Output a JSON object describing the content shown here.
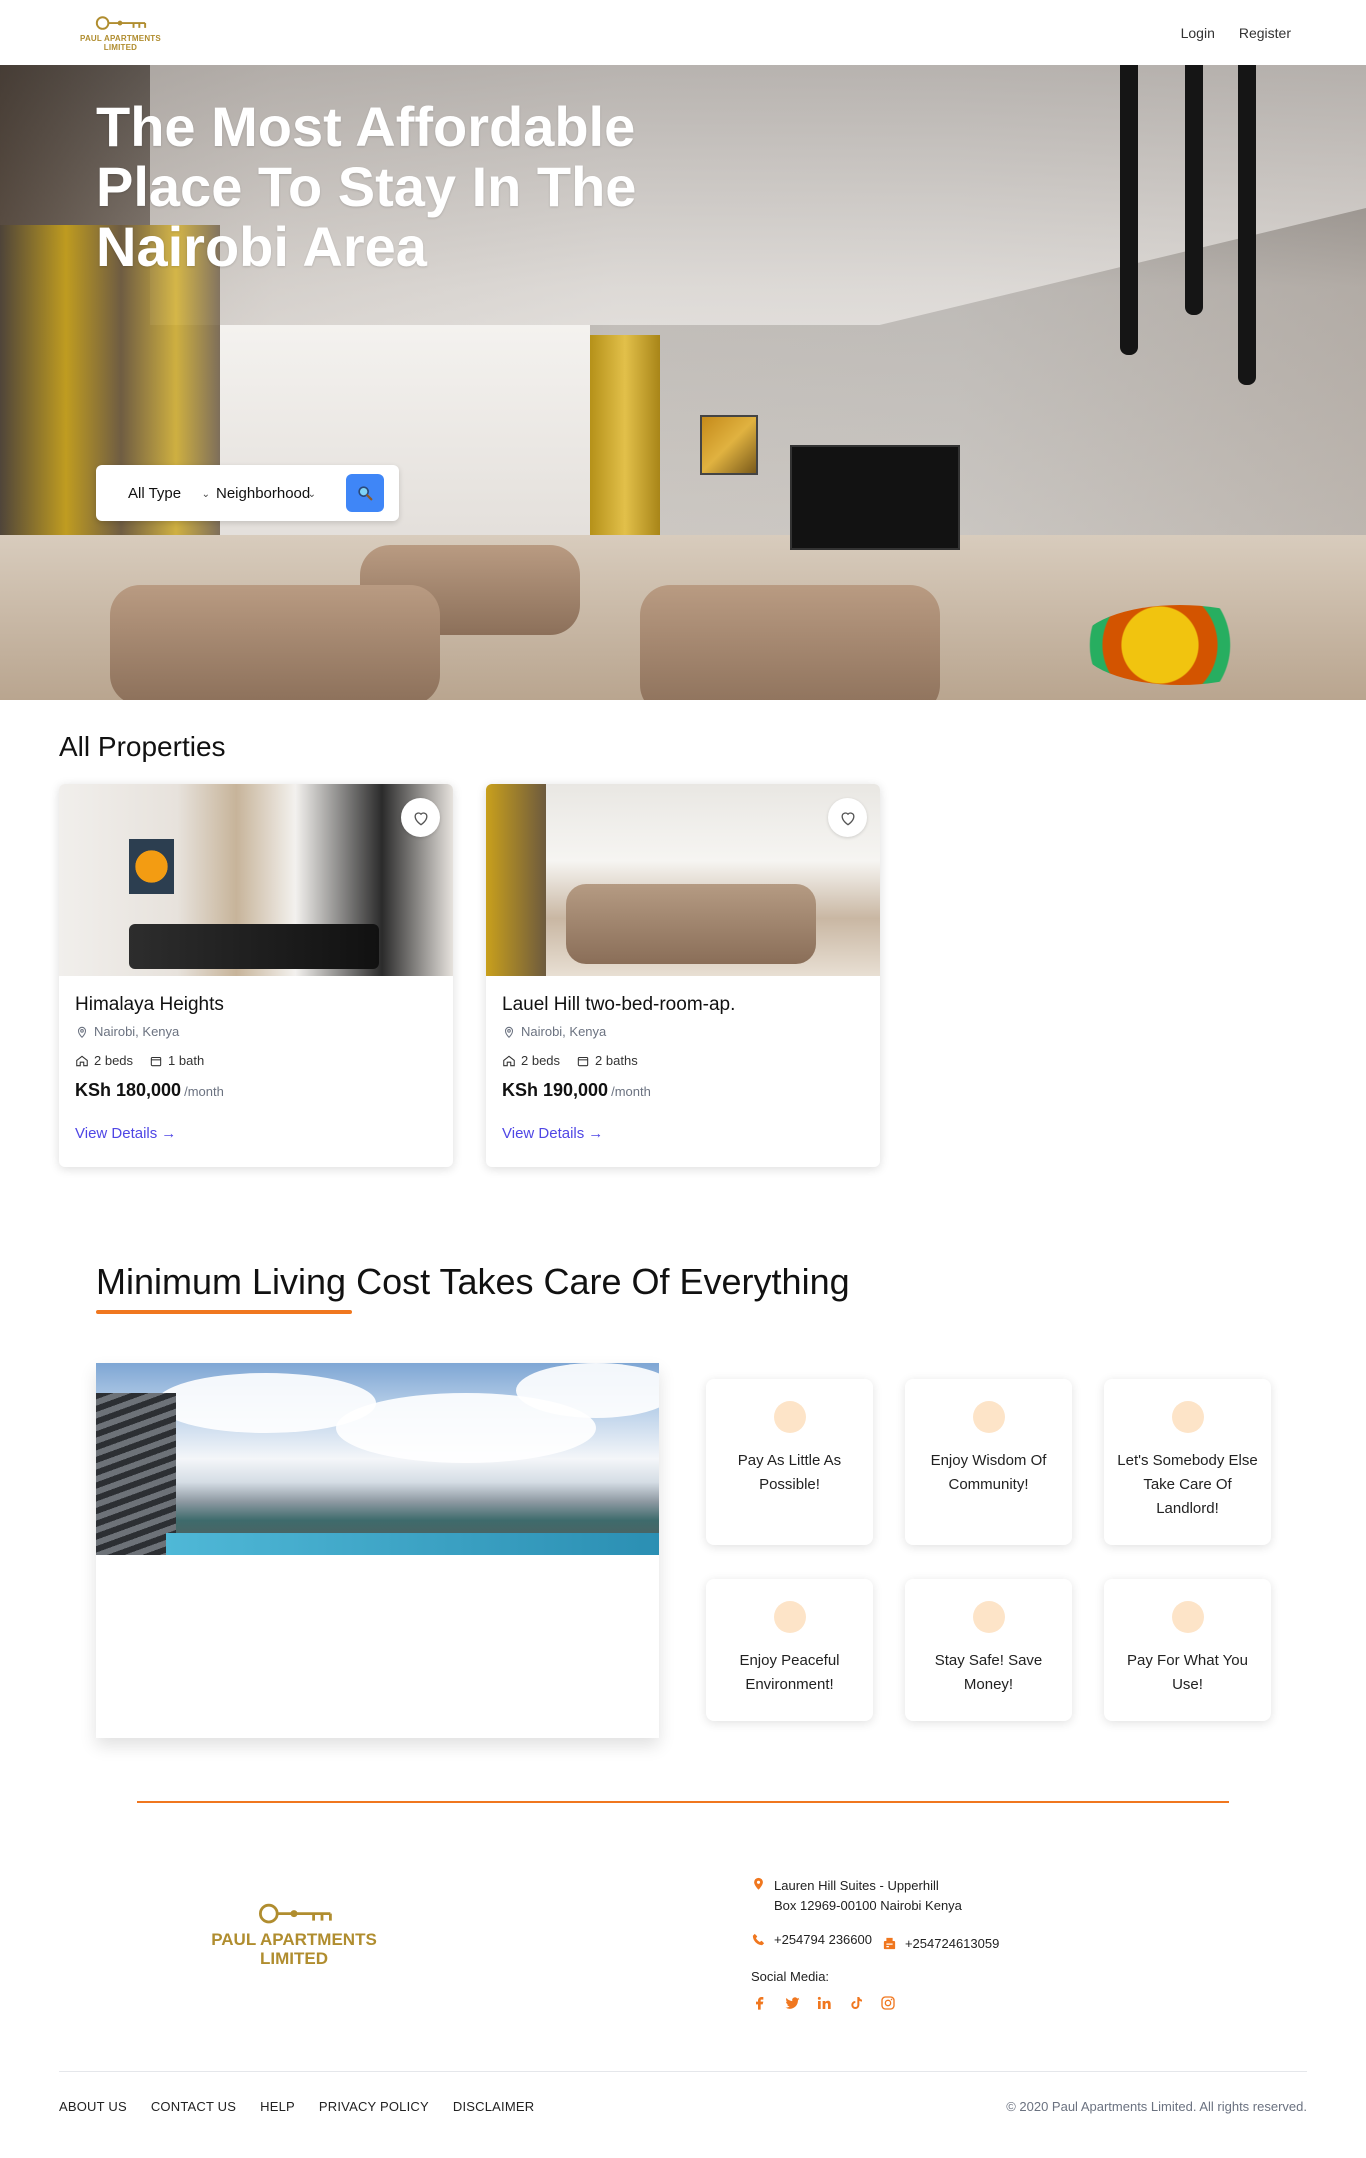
{
  "brand": {
    "name_line1": "PAUL APARTMENTS",
    "name_line2": "LIMITED",
    "color": "#b08d2f"
  },
  "header": {
    "login_label": "Login",
    "register_label": "Register"
  },
  "hero": {
    "title": "The Most Affordable Place To Stay In The Nairobi Area",
    "type_select": "All Type",
    "neighborhood_select": "Neighborhood",
    "search_icon": "search-icon",
    "search_button_color": "#3f86f7"
  },
  "properties": {
    "title": "All Properties",
    "items": [
      {
        "name": "Himalaya Heights",
        "location": "Nairobi, Kenya",
        "beds": "2 beds",
        "baths": "1 bath",
        "price": "KSh 180,000",
        "period": "/month",
        "link": "View Details"
      },
      {
        "name": "Lauel Hill two-bed-room-ap.",
        "location": "Nairobi, Kenya",
        "beds": "2 beds",
        "baths": "2 baths",
        "price": "KSh 190,000",
        "period": "/month",
        "link": "View Details"
      }
    ],
    "link_color": "#4f46e5"
  },
  "features": {
    "title": "Minimum Living Cost Takes Care Of Everything",
    "accent_color": "#f0771f",
    "items": [
      "Pay As Little As Possible!",
      "Enjoy Wisdom Of Community!",
      "Let's Somebody Else Take Care Of Landlord!",
      "Enjoy Peaceful Environment!",
      "Stay Safe! Save Money!",
      "Pay For What You Use!"
    ]
  },
  "footer": {
    "address_line1": "Lauren Hill Suites - Upperhill",
    "address_line2": "Box 12969-00100 Nairobi Kenya",
    "phone1": "+254794 236600",
    "phone2": "+254724613059",
    "social_label": "Social Media:",
    "social_icons": [
      "facebook-icon",
      "twitter-icon",
      "linkedin-icon",
      "tiktok-icon",
      "instagram-icon"
    ],
    "links": [
      "ABOUT US",
      "CONTACT US",
      "HELP",
      "PRIVACY POLICY",
      "DISCLAIMER"
    ],
    "copyright": "© 2020 Paul Apartments Limited. All rights reserved."
  }
}
